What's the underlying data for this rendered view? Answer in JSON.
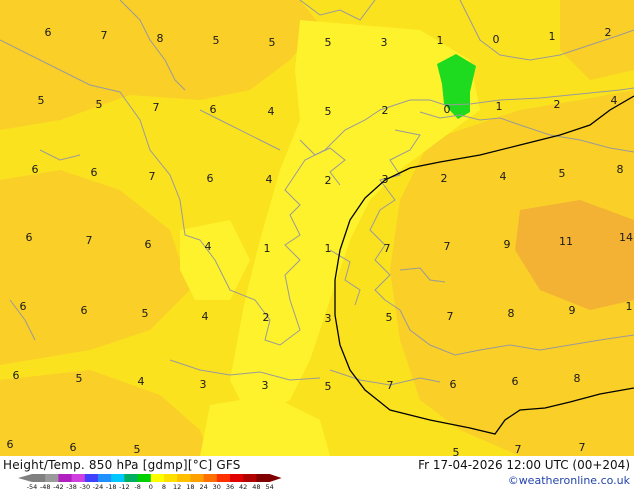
{
  "footer": {
    "title_left": "Height/Temp. 850 hPa [gdmp][°C] GFS",
    "title_right": "Fr 17-04-2026 12:00 UTC (00+204)",
    "credit": "©weatheronline.co.uk"
  },
  "colorbar": {
    "ticks": [
      "-54",
      "-48",
      "-42",
      "-38",
      "-30",
      "-24",
      "-18",
      "-12",
      "-8",
      "0",
      "8",
      "12",
      "18",
      "24",
      "30",
      "36",
      "42",
      "48",
      "54"
    ],
    "colors": [
      "#808080",
      "#9a9a9a",
      "#b020c0",
      "#d040e0",
      "#4040ff",
      "#2090ff",
      "#00c8ff",
      "#00b060",
      "#00d000",
      "#ffff00",
      "#ffe000",
      "#ffc000",
      "#ffa000",
      "#ff7000",
      "#ff3000",
      "#e00000",
      "#b00000",
      "#800000"
    ]
  },
  "map": {
    "colors": {
      "base": "#fbe21f",
      "warm": "#f9cf28",
      "cool": "#fdf22b",
      "hot": "#f4b234",
      "green": "#1fdb1f",
      "coast": "#9a9a9a",
      "front": "#000000"
    },
    "labels": [
      {
        "t": "6"
      },
      {
        "t": "7"
      },
      {
        "t": "8"
      },
      {
        "t": "5"
      },
      {
        "t": "5"
      },
      {
        "t": "5"
      },
      {
        "t": "3"
      },
      {
        "t": "1"
      },
      {
        "t": "0"
      },
      {
        "t": "1"
      },
      {
        "t": "2"
      },
      {
        "t": "5"
      },
      {
        "t": "5"
      },
      {
        "t": "7"
      },
      {
        "t": "6"
      },
      {
        "t": "4"
      },
      {
        "t": "5"
      },
      {
        "t": "2"
      },
      {
        "t": "0"
      },
      {
        "t": "1"
      },
      {
        "t": "2"
      },
      {
        "t": "4"
      },
      {
        "t": "6"
      },
      {
        "t": "6"
      },
      {
        "t": "7"
      },
      {
        "t": "6"
      },
      {
        "t": "4"
      },
      {
        "t": "2"
      },
      {
        "t": "3"
      },
      {
        "t": "2"
      },
      {
        "t": "4"
      },
      {
        "t": "5"
      },
      {
        "t": "8"
      },
      {
        "t": "6"
      },
      {
        "t": "7"
      },
      {
        "t": "6"
      },
      {
        "t": "4"
      },
      {
        "t": "1"
      },
      {
        "t": "1"
      },
      {
        "t": "7"
      },
      {
        "t": "7"
      },
      {
        "t": "9"
      },
      {
        "t": "11"
      },
      {
        "t": "14"
      },
      {
        "t": "6"
      },
      {
        "t": "6"
      },
      {
        "t": "5"
      },
      {
        "t": "4"
      },
      {
        "t": "2"
      },
      {
        "t": "3"
      },
      {
        "t": "5"
      },
      {
        "t": "7"
      },
      {
        "t": "8"
      },
      {
        "t": "9"
      },
      {
        "t": "1"
      },
      {
        "t": "6"
      },
      {
        "t": "5"
      },
      {
        "t": "4"
      },
      {
        "t": "3"
      },
      {
        "t": "3"
      },
      {
        "t": "5"
      },
      {
        "t": "7"
      },
      {
        "t": "6"
      },
      {
        "t": "6"
      },
      {
        "t": "8"
      },
      {
        "t": "6"
      },
      {
        "t": "6"
      },
      {
        "t": "5"
      },
      {
        "t": "5"
      },
      {
        "t": "7"
      },
      {
        "t": "7"
      }
    ]
  }
}
